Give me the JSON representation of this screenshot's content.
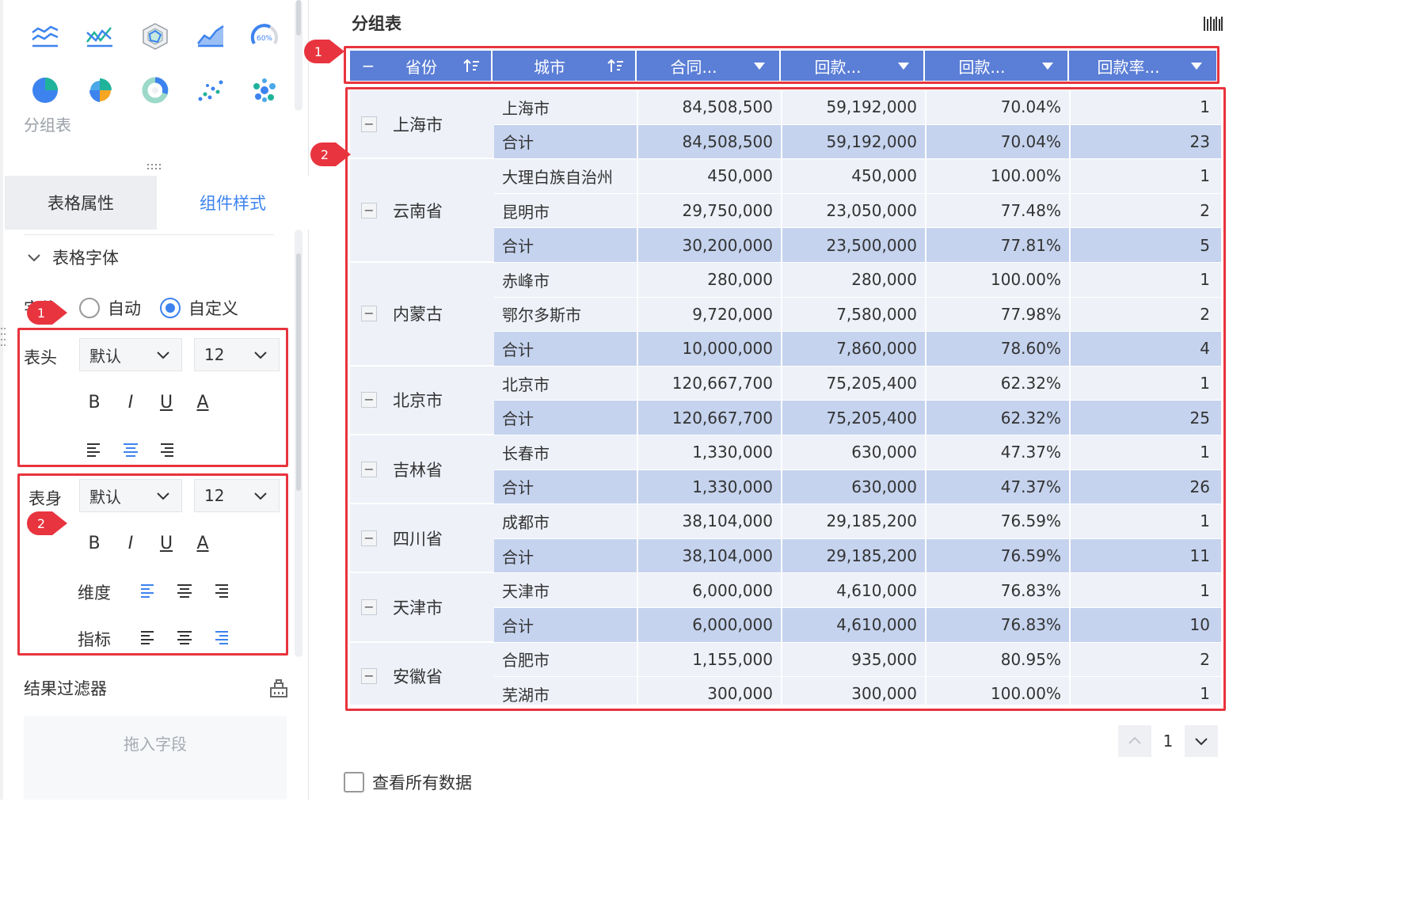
{
  "left_panel": {
    "chart_type_label": "分组表",
    "chart_icons": [
      "line-chart-icon",
      "area-line-chart-icon",
      "radar-chart-icon",
      "area-chart-icon",
      "gauge-chart-icon",
      "pie-chart-icon",
      "rose-pie-chart-icon",
      "ring-chart-icon",
      "scatter-chart-icon",
      "bubble-chart-icon"
    ],
    "gauge_text": "60%",
    "tabs": {
      "props": "表格属性",
      "style": "组件样式"
    },
    "section_title": "表格字体",
    "mode_label": "字体",
    "mode_options": [
      "自动",
      "自定义"
    ],
    "mode_selected": "自定义",
    "header_font": {
      "label": "表头",
      "family": "默认",
      "size": "12"
    },
    "body_font": {
      "label": "表身",
      "family": "默认",
      "size": "12",
      "dimension_label": "维度",
      "metric_label": "指标"
    },
    "format_glyphs": {
      "bold": "B",
      "italic": "I",
      "underline": "U",
      "color": "A"
    },
    "filter_title": "结果过滤器",
    "filter_drop_hint": "拖入字段"
  },
  "badges": {
    "one": "1",
    "two": "2"
  },
  "widget": {
    "title": "分组表",
    "columns": [
      "省份",
      "城市",
      "合同...",
      "回款...",
      "回款...",
      "回款率..."
    ],
    "header_collapse": "−",
    "groups": [
      {
        "province": "上海市",
        "rows": [
          {
            "type": "detail",
            "cells": [
              "上海市",
              "84,508,500",
              "59,192,000",
              "70.04%",
              "1"
            ]
          },
          {
            "type": "total",
            "cells": [
              "合计",
              "84,508,500",
              "59,192,000",
              "70.04%",
              "23"
            ]
          }
        ]
      },
      {
        "province": "云南省",
        "rows": [
          {
            "type": "detail",
            "cells": [
              "大理白族自治州",
              "450,000",
              "450,000",
              "100.00%",
              "1"
            ]
          },
          {
            "type": "detail",
            "cells": [
              "昆明市",
              "29,750,000",
              "23,050,000",
              "77.48%",
              "2"
            ]
          },
          {
            "type": "total",
            "cells": [
              "合计",
              "30,200,000",
              "23,500,000",
              "77.81%",
              "5"
            ]
          }
        ]
      },
      {
        "province": "内蒙古",
        "rows": [
          {
            "type": "detail",
            "cells": [
              "赤峰市",
              "280,000",
              "280,000",
              "100.00%",
              "1"
            ]
          },
          {
            "type": "detail",
            "cells": [
              "鄂尔多斯市",
              "9,720,000",
              "7,580,000",
              "77.98%",
              "2"
            ]
          },
          {
            "type": "total",
            "cells": [
              "合计",
              "10,000,000",
              "7,860,000",
              "78.60%",
              "4"
            ]
          }
        ]
      },
      {
        "province": "北京市",
        "rows": [
          {
            "type": "detail",
            "cells": [
              "北京市",
              "120,667,700",
              "75,205,400",
              "62.32%",
              "1"
            ]
          },
          {
            "type": "total",
            "cells": [
              "合计",
              "120,667,700",
              "75,205,400",
              "62.32%",
              "25"
            ]
          }
        ]
      },
      {
        "province": "吉林省",
        "rows": [
          {
            "type": "detail",
            "cells": [
              "长春市",
              "1,330,000",
              "630,000",
              "47.37%",
              "1"
            ]
          },
          {
            "type": "total",
            "cells": [
              "合计",
              "1,330,000",
              "630,000",
              "47.37%",
              "26"
            ]
          }
        ]
      },
      {
        "province": "四川省",
        "rows": [
          {
            "type": "detail",
            "cells": [
              "成都市",
              "38,104,000",
              "29,185,200",
              "76.59%",
              "1"
            ]
          },
          {
            "type": "total",
            "cells": [
              "合计",
              "38,104,000",
              "29,185,200",
              "76.59%",
              "11"
            ]
          }
        ]
      },
      {
        "province": "天津市",
        "rows": [
          {
            "type": "detail",
            "cells": [
              "天津市",
              "6,000,000",
              "4,610,000",
              "76.83%",
              "1"
            ]
          },
          {
            "type": "total",
            "cells": [
              "合计",
              "6,000,000",
              "4,610,000",
              "76.83%",
              "10"
            ]
          }
        ]
      },
      {
        "province": "安徽省",
        "rows": [
          {
            "type": "detail",
            "cells": [
              "合肥市",
              "1,155,000",
              "935,000",
              "80.95%",
              "2"
            ]
          },
          {
            "type": "detail",
            "cells": [
              "芜湖市",
              "300,000",
              "300,000",
              "100.00%",
              "1"
            ]
          }
        ]
      }
    ],
    "pager": {
      "page": "1"
    },
    "view_all_label": "查看所有数据"
  },
  "colors": {
    "accent": "#3d83ef",
    "header_bg": "#5b7ed6",
    "row_bg": "#eef1f8",
    "total_bg": "#c5d3ee",
    "annotation_red": "#e8343e"
  }
}
